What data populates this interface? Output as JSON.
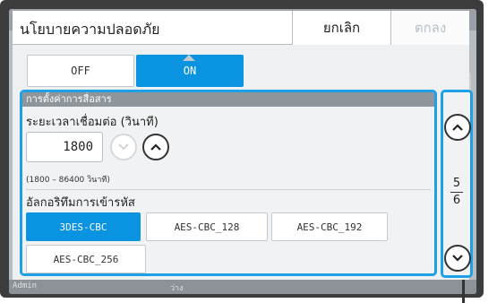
{
  "dialog": {
    "title": "นโยบายความปลอดภัย",
    "cancel_label": "ยกเลิก",
    "ok_label": "ตกลง"
  },
  "toggle": {
    "off_label": "OFF",
    "on_label": "ON",
    "selected": "ON"
  },
  "communication": {
    "section_header": "การตั้งค่าการสื่อสาร",
    "timeout_label": "ระยะเวลาเชื่อมต่อ (วินาที)",
    "timeout_value": "1800",
    "timeout_range": "(1800 – 86400 วินาที)",
    "encryption_label": "อัลกอริทึมการเข้ารหัส",
    "algorithms": [
      "3DES-CBC",
      "AES-CBC_128",
      "AES-CBC_192",
      "AES-CBC_256"
    ],
    "selected_algorithm": "3DES-CBC"
  },
  "pager": {
    "current": "5",
    "total": "6"
  },
  "background_status": {
    "user": "Admin",
    "state": "ว่าง"
  },
  "colors": {
    "accent": "#0a93e0",
    "highlight_border": "#1ea0e6"
  }
}
